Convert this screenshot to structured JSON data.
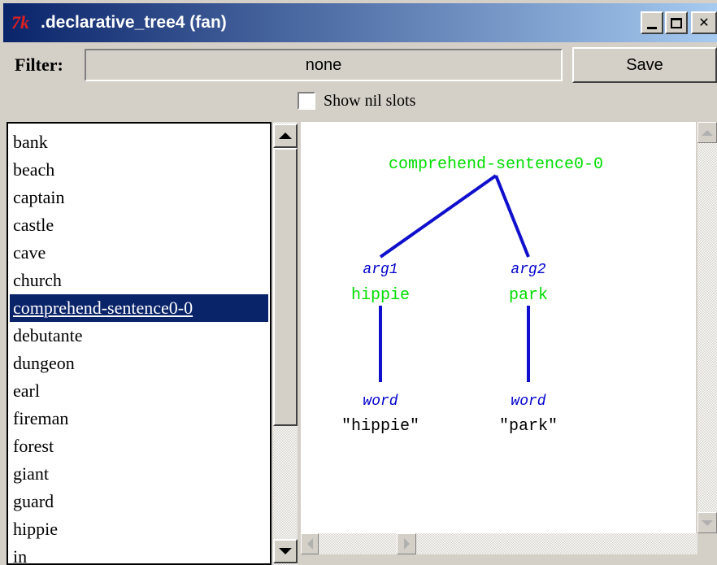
{
  "window": {
    "title": ".declarative_tree4 (fan)",
    "app_icon_glyph": "7k",
    "controls": {
      "minimize": "_",
      "maximize": "□",
      "close": "✕"
    }
  },
  "filter": {
    "label": "Filter:",
    "value": "none"
  },
  "save_button": {
    "label": "Save"
  },
  "show_nil_slots": {
    "label": "Show nil slots",
    "checked": false
  },
  "chunk_list": {
    "selected": "comprehend-sentence0-0",
    "items": [
      "bank",
      "beach",
      "captain",
      "castle",
      "cave",
      "church",
      "comprehend-sentence0-0",
      "debutante",
      "dungeon",
      "earl",
      "fireman",
      "forest",
      "giant",
      "guard",
      "hippie",
      "in"
    ]
  },
  "tree": {
    "root": "comprehend-sentence0-0",
    "children": [
      {
        "slot": "arg1",
        "value": "hippie",
        "sub_slot": "word",
        "sub_value": "\"hippie\""
      },
      {
        "slot": "arg2",
        "value": "park",
        "sub_slot": "word",
        "sub_value": "\"park\""
      }
    ]
  },
  "colors": {
    "titlebar_start": "#0a246a",
    "titlebar_end": "#a6caf0",
    "selection": "#0a246a",
    "node_green": "#00dd00",
    "slot_blue": "#0000cc",
    "edge_blue": "#1010cc"
  }
}
